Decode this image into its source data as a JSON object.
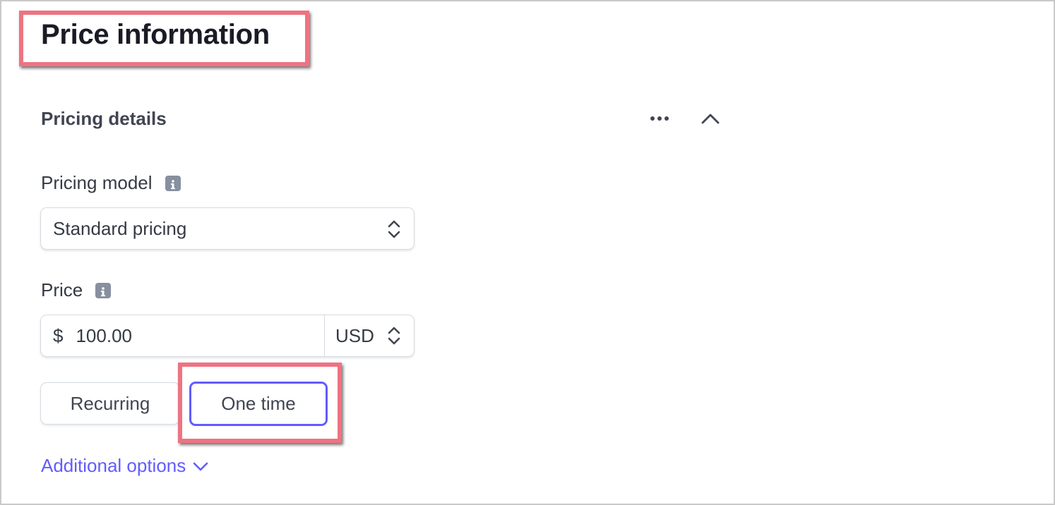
{
  "page": {
    "title": "Price information"
  },
  "section": {
    "title": "Pricing details",
    "more_icon": "more-horizontal-icon",
    "collapse_icon": "chevron-up-icon"
  },
  "pricing_model": {
    "label": "Pricing model",
    "info_icon": "info-icon",
    "selected_value": "Standard pricing"
  },
  "price": {
    "label": "Price",
    "info_icon": "info-icon",
    "currency_symbol": "$",
    "amount": "100.00",
    "currency": "USD"
  },
  "billing_type": {
    "options": [
      "Recurring",
      "One time"
    ],
    "selected": "One time"
  },
  "additional_options": {
    "label": "Additional options"
  },
  "colors": {
    "accent": "#635bff",
    "annotation": "#ee7382",
    "text": "#353a44",
    "title": "#1a1b25"
  }
}
